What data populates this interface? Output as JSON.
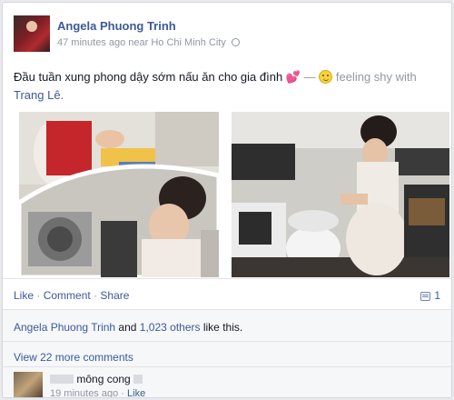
{
  "post": {
    "author": "Angela Phuong Trinh",
    "time": "47 minutes ago near Ho Chi Minh City",
    "status_text": "Đầu tuần xung phong dậy sớm nấu ăn cho gia đình",
    "dash": "—",
    "feeling": "feeling shy with",
    "tagged": "Trang Lê."
  },
  "actions": {
    "like": "Like",
    "comment": "Comment",
    "share": "Share",
    "comment_count": "1",
    "separator": "·"
  },
  "likes": {
    "name": "Angela Phuong Trinh",
    "connector": " and ",
    "others": "1,023 others",
    "suffix": " like this."
  },
  "comments": {
    "view_more": "View 22 more comments",
    "author_visible": "mông cong",
    "time": "19 minutes ago",
    "like": "Like"
  },
  "colors": {
    "link": "#3b5998",
    "muted": "#9197a3"
  }
}
